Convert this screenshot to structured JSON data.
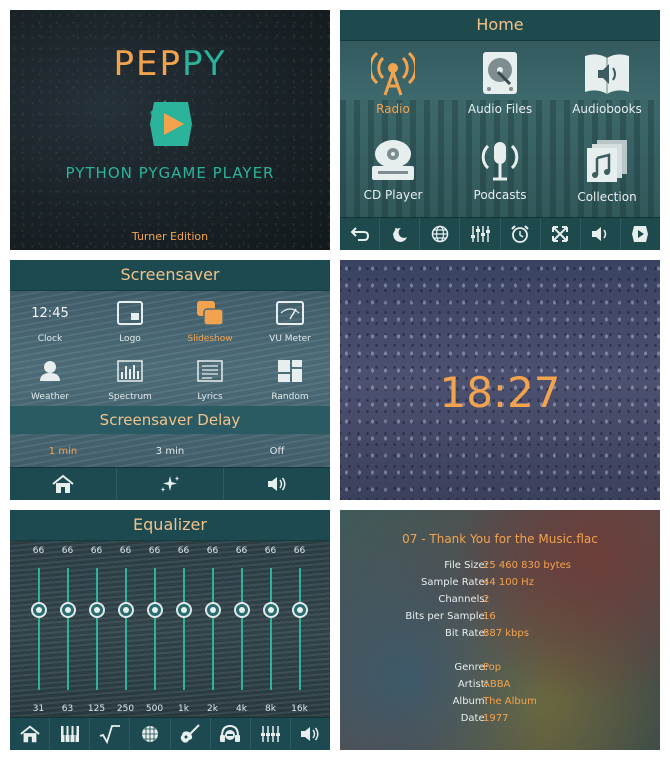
{
  "splash": {
    "title_part1": "PEP",
    "title_part2": "PY",
    "subtitle": "PYTHON PYGAME PLAYER",
    "edition": "Turner Edition"
  },
  "home": {
    "header": "Home",
    "items": [
      {
        "label": "Radio",
        "icon": "radio-tower-icon",
        "active": true
      },
      {
        "label": "Audio Files",
        "icon": "hard-drive-icon",
        "active": false
      },
      {
        "label": "Audiobooks",
        "icon": "book-speaker-icon",
        "active": false
      },
      {
        "label": "CD Player",
        "icon": "cd-player-icon",
        "active": false
      },
      {
        "label": "Podcasts",
        "icon": "podcast-mic-icon",
        "active": false
      },
      {
        "label": "Collection",
        "icon": "collection-icon",
        "active": false
      }
    ],
    "navbar": [
      "back-icon",
      "screensaver-icon",
      "globe-icon",
      "equalizer-icon",
      "alarm-clock-icon",
      "fullscreen-icon",
      "volume-icon",
      "player-icon"
    ]
  },
  "screensaver": {
    "header": "Screensaver",
    "items": [
      {
        "label": "Clock",
        "icon": "clock-text",
        "text": "12:45"
      },
      {
        "label": "Logo",
        "icon": "logo-icon"
      },
      {
        "label": "Slideshow",
        "icon": "slideshow-icon",
        "active": true
      },
      {
        "label": "VU Meter",
        "icon": "vu-meter-icon"
      },
      {
        "label": "Weather",
        "icon": "weather-icon"
      },
      {
        "label": "Spectrum",
        "icon": "spectrum-icon"
      },
      {
        "label": "Lyrics",
        "icon": "lyrics-icon"
      },
      {
        "label": "Random",
        "icon": "random-icon"
      }
    ],
    "delay_header": "Screensaver Delay",
    "delays": [
      {
        "label": "1 min",
        "active": true
      },
      {
        "label": "3 min",
        "active": false
      },
      {
        "label": "Off",
        "active": false
      }
    ],
    "navbar": [
      "home-icon",
      "sparkles-icon",
      "volume-icon"
    ]
  },
  "clock": {
    "time": "18:27"
  },
  "equalizer": {
    "header": "Equalizer",
    "bands": [
      {
        "freq": "31",
        "value": "66"
      },
      {
        "freq": "63",
        "value": "66"
      },
      {
        "freq": "125",
        "value": "66"
      },
      {
        "freq": "250",
        "value": "66"
      },
      {
        "freq": "500",
        "value": "66"
      },
      {
        "freq": "1k",
        "value": "66"
      },
      {
        "freq": "2k",
        "value": "66"
      },
      {
        "freq": "4k",
        "value": "66"
      },
      {
        "freq": "8k",
        "value": "66"
      },
      {
        "freq": "16k",
        "value": "66"
      }
    ],
    "navbar": [
      "home-icon",
      "piano-icon",
      "sqrt-icon",
      "globe-icon",
      "guitar-icon",
      "headphones-icon",
      "equalizer-icon",
      "volume-icon"
    ]
  },
  "fileinfo": {
    "title": "07 - Thank You for the Music.flac",
    "rows": [
      {
        "key": "File Size:",
        "value": "25 460 830 bytes"
      },
      {
        "key": "Sample Rate:",
        "value": "44 100 Hz"
      },
      {
        "key": "Channels:",
        "value": "2"
      },
      {
        "key": "Bits per Sample:",
        "value": "16"
      },
      {
        "key": "Bit Rate:",
        "value": "887 kbps"
      },
      {
        "key": "Genre:",
        "value": "Pop"
      },
      {
        "key": "Artist:",
        "value": "ABBA"
      },
      {
        "key": "Album:",
        "value": "The Album"
      },
      {
        "key": "Date:",
        "value": "1977"
      }
    ]
  },
  "colors": {
    "accent": "#f3a34d",
    "brand": "#2bb39b",
    "bar": "#1e4a4e"
  }
}
